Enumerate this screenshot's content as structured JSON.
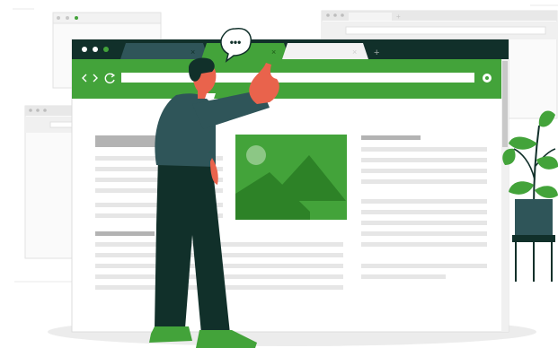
{
  "illustration": {
    "speech_bubble_text": "•••",
    "new_tab_symbol": "+",
    "tab_close_symbol": "×",
    "icons": [
      "back-arrow-icon",
      "forward-arrow-icon",
      "reload-icon",
      "profile-icon",
      "image-icon",
      "plant",
      "person-pointing"
    ]
  },
  "colors": {
    "brand_green": "#43a33a",
    "dark_green": "#11302a",
    "teal": "#2f5559",
    "skin": "#e9634c",
    "line_gray": "#e6e6e6",
    "heading_gray": "#b3b3b3"
  }
}
